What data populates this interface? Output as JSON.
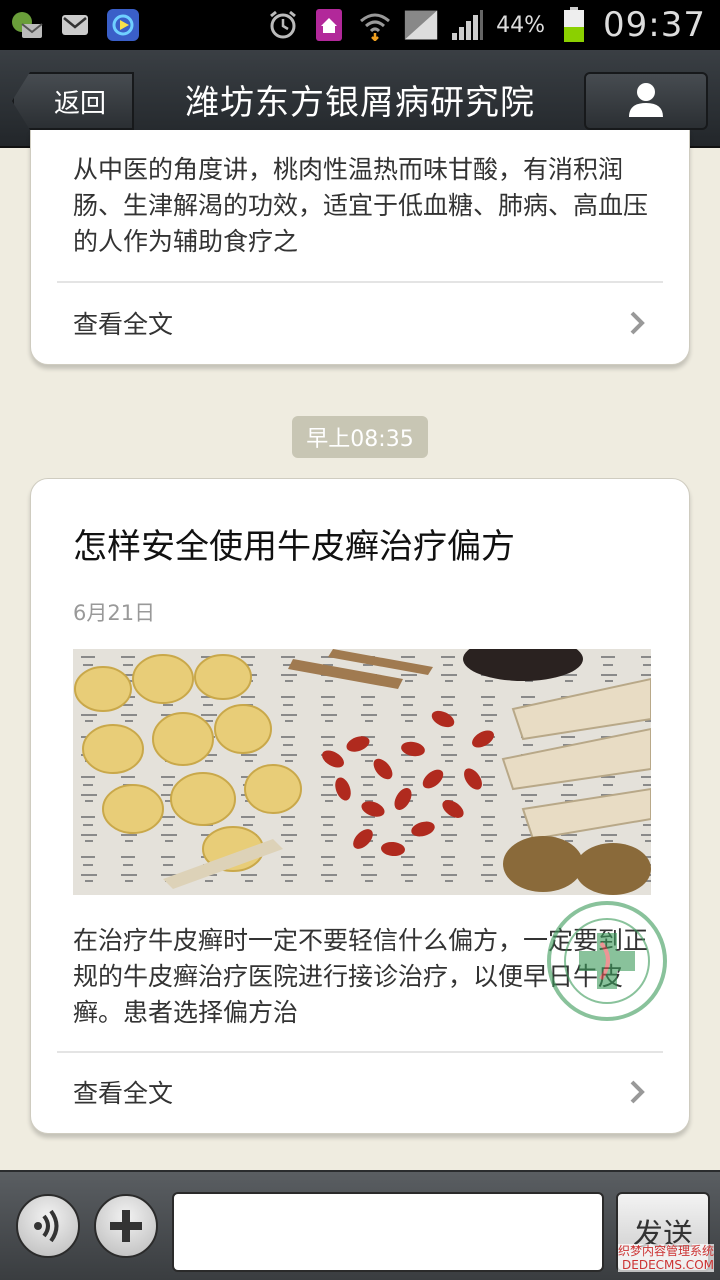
{
  "status_bar": {
    "battery_percent": "44%",
    "time": "09:37"
  },
  "header": {
    "back_label": "返回",
    "title": "潍坊东方银屑病研究院"
  },
  "previous_article": {
    "summary": "从中医的角度讲，桃肉性温热而味甘酸，有消积润肠、生津解渴的功效，适宜于低血糖、肺病、高血压的人作为辅助食疗之",
    "read_more": "查看全文"
  },
  "timestamp": "早上08:35",
  "article": {
    "title": "怎样安全使用牛皮癣治疗偏方",
    "date": "6月21日",
    "summary": "在治疗牛皮癣时一定不要轻信什么偏方，一定要到正规的牛皮癣治疗医院进行接诊治疗，以便早日牛皮癣。患者选择偏方治",
    "read_more": "查看全文"
  },
  "composer": {
    "input_value": "",
    "send_label": "发送"
  },
  "corner_watermark": {
    "line1": "织梦内容管理系统",
    "line2": "DEDECMS.COM"
  },
  "colors": {
    "page_bg": "#efece0",
    "header_bg": "#2b2f33",
    "time_chip_bg": "#c8c6b4"
  }
}
